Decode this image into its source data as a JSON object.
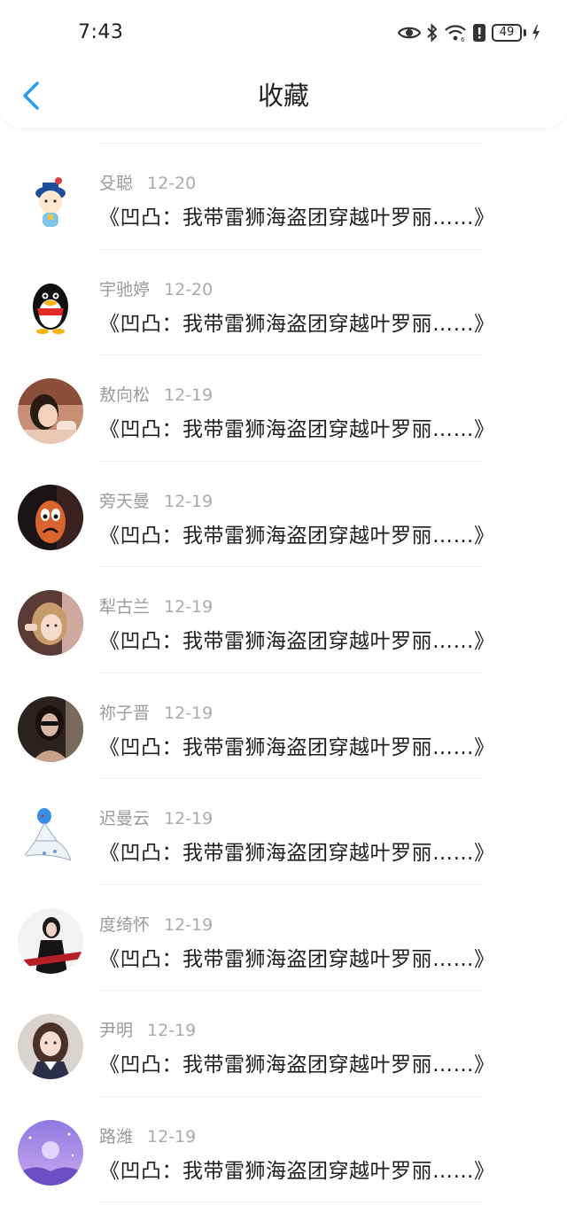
{
  "status_bar": {
    "time": "7:43",
    "battery_level": "49",
    "icons": [
      "eye-icon",
      "bluetooth-icon",
      "wifi-icon",
      "alert-icon",
      "battery-icon",
      "charging-icon"
    ]
  },
  "header": {
    "title": "收藏",
    "back_icon": "chevron-left-icon",
    "accent_color": "#2f9bf0"
  },
  "favorites": [
    {
      "name": "殳聪",
      "date": "12-20",
      "title": "《凹凸：我带雷狮海盗团穿越叶罗丽……》",
      "avatar": "cartoon-official"
    },
    {
      "name": "宇驰婷",
      "date": "12-20",
      "title": "《凹凸：我带雷狮海盗团穿越叶罗丽……》",
      "avatar": "penguin"
    },
    {
      "name": "敖向松",
      "date": "12-19",
      "title": "《凹凸：我带雷狮海盗团穿越叶罗丽……》",
      "avatar": "photo-girl"
    },
    {
      "name": "旁天曼",
      "date": "12-19",
      "title": "《凹凸：我带雷狮海盗团穿越叶罗丽……》",
      "avatar": "egg-face"
    },
    {
      "name": "犁古兰",
      "date": "12-19",
      "title": "《凹凸：我带雷狮海盗团穿越叶罗丽……》",
      "avatar": "photo-girl-blond"
    },
    {
      "name": "祢子晋",
      "date": "12-19",
      "title": "《凹凸：我带雷狮海盗团穿越叶罗丽……》",
      "avatar": "photo-dark"
    },
    {
      "name": "迟曼云",
      "date": "12-19",
      "title": "《凹凸：我带雷狮海盗团穿越叶罗丽……》",
      "avatar": "pokemon"
    },
    {
      "name": "度绮怀",
      "date": "12-19",
      "title": "《凹凸：我带雷狮海盗团穿越叶罗丽……》",
      "avatar": "photo-girl-black"
    },
    {
      "name": "尹明",
      "date": "12-19",
      "title": "《凹凸：我带雷狮海盗团穿越叶罗丽……》",
      "avatar": "photo-girl-uniform"
    },
    {
      "name": "路潍",
      "date": "12-19",
      "title": "《凹凸：我带雷狮海盗团穿越叶罗丽……》",
      "avatar": "purple-scenery"
    }
  ]
}
